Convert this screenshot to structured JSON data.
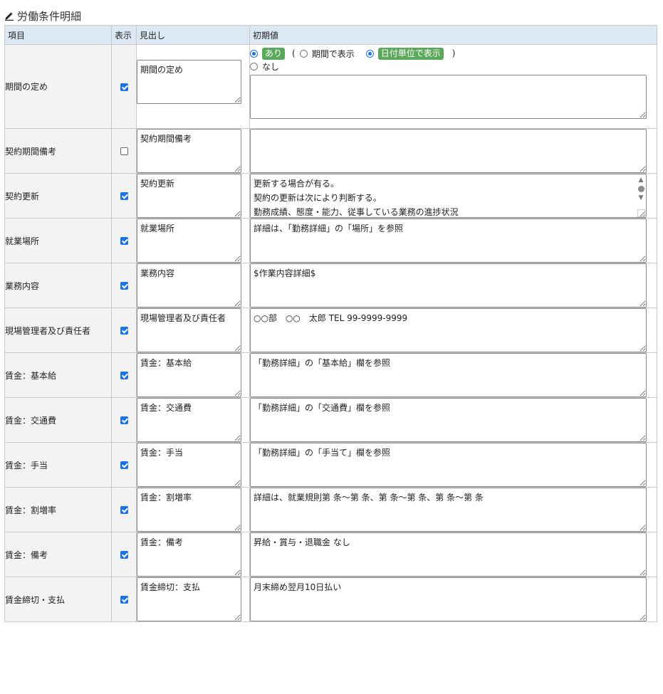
{
  "page": {
    "title": "労働条件明細"
  },
  "columns": {
    "item": "項目",
    "show": "表示",
    "heading": "見出し",
    "initial": "初期値"
  },
  "period_options": {
    "yes": "あり",
    "open_paren": "(",
    "by_period": "期間で表示",
    "by_date": "日付単位で表示",
    "close_paren": ")",
    "no": "なし"
  },
  "rows": [
    {
      "item": "期間の定め",
      "show": true,
      "heading": "期間の定め",
      "initial": ""
    },
    {
      "item": "契約期間備考",
      "show": false,
      "heading": "契約期間備考",
      "initial": ""
    },
    {
      "item": "契約更新",
      "show": true,
      "heading": "契約更新",
      "initial": "更新する場合が有る。\n契約の更新は次により判断する。\n勤務成績、態度・能力、従事している業務の進捗状況"
    },
    {
      "item": "就業場所",
      "show": true,
      "heading": "就業場所",
      "initial": "詳細は、「勤務詳細」の「場所」を参照"
    },
    {
      "item": "業務内容",
      "show": true,
      "heading": "業務内容",
      "initial": "$作業内容詳細$"
    },
    {
      "item": "現場管理者及び責任者",
      "show": true,
      "heading": "現場管理者及び責任者",
      "initial": "○○部　○○　太郎 TEL 99-9999-9999"
    },
    {
      "item": "賃金：基本給",
      "show": true,
      "heading": "賃金：基本給",
      "initial": "「勤務詳細」の「基本給」欄を参照"
    },
    {
      "item": "賃金：交通費",
      "show": true,
      "heading": "賃金：交通費",
      "initial": "「勤務詳細」の「交通費」欄を参照"
    },
    {
      "item": "賃金：手当",
      "show": true,
      "heading": "賃金：手当",
      "initial": "「勤務詳細」の「手当て」欄を参照"
    },
    {
      "item": "賃金：割増率",
      "show": true,
      "heading": "賃金：割増率",
      "initial": "詳細は、就業規則第 条～第 条、第 条～第 条、第 条～第 条"
    },
    {
      "item": "賃金：備考",
      "show": true,
      "heading": "賃金：備考",
      "initial": "昇給・賞与・退職金 なし"
    },
    {
      "item": "賃金締切・支払",
      "show": true,
      "heading": "賃金締切：支払",
      "initial": "月末締め翌月10日払い"
    }
  ]
}
